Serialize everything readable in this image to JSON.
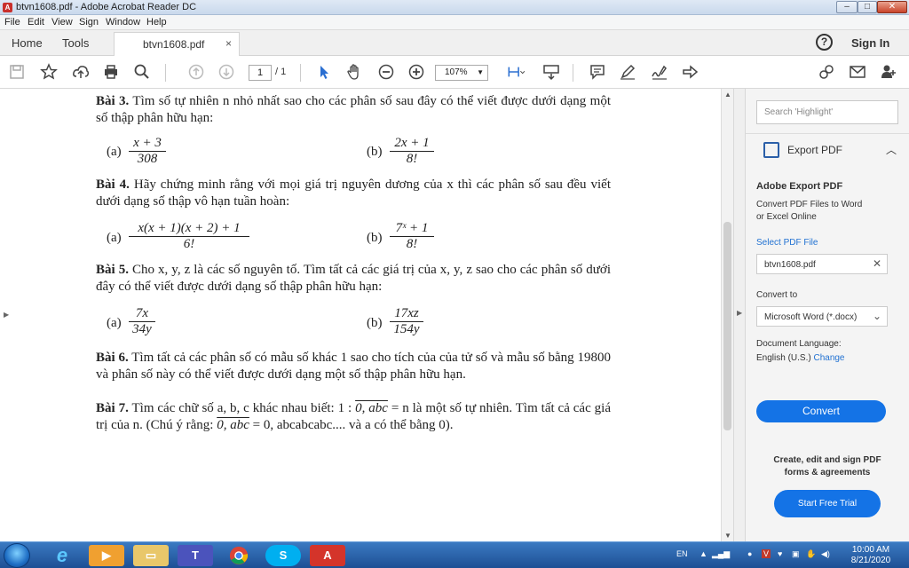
{
  "window": {
    "title": "btvn1608.pdf - Adobe Acrobat Reader DC",
    "min": "‒",
    "max": "□",
    "close": "✕"
  },
  "menu": [
    "File",
    "Edit",
    "View",
    "Sign",
    "Window",
    "Help"
  ],
  "tabs": {
    "home": "Home",
    "tools": "Tools",
    "doc": "btvn1608.pdf",
    "close": "×",
    "help": "?",
    "signin": "Sign In"
  },
  "toolbar": {
    "page": "1",
    "page_total": "/ 1",
    "zoom": "107%"
  },
  "document": {
    "b3": {
      "title": "Bài 3.",
      "text": "Tìm số tự nhiên n nhỏ nhất sao cho các phân số sau đây có thể viết được dưới dạng một số thập phân hữu hạn:",
      "a_label": "(a)",
      "a_num": "x + 3",
      "a_den": "308",
      "b_label": "(b)",
      "b_num": "2x + 1",
      "b_den": "8!"
    },
    "b4": {
      "title": "Bài 4.",
      "text": "Hãy chứng minh rằng với mọi giá trị nguyên dương của x thì các phân số sau đều viết dưới dạng số thập vô hạn tuần hoàn:",
      "a_label": "(a)",
      "a_num": "x(x + 1)(x + 2) + 1",
      "a_den": "6!",
      "b_label": "(b)",
      "b_num": "7ˣ + 1",
      "b_den": "8!"
    },
    "b5": {
      "title": "Bài 5.",
      "text": "Cho x, y, z là các số nguyên tố. Tìm tất cả các giá trị của x, y, z sao cho các phân số dưới đây có thể viết được dưới dạng số thập phân hữu hạn:",
      "a_label": "(a)",
      "a_num": "7x",
      "a_den": "34y",
      "b_label": "(b)",
      "b_num": "17xz",
      "b_den": "154y"
    },
    "b6": {
      "title": "Bài 6.",
      "text": "Tìm tất cả các phân số có mẫu số khác 1 sao cho tích của của tử số và mẫu số bằng 19800 và phân số này có thể viết được dưới dạng một số thập phân hữu hạn."
    },
    "b7": {
      "title": "Bài 7.",
      "text1": "Tìm các chữ số a, b, c khác nhau biết: 1 : ",
      "ovl1": "0, abc",
      "text2": " = n là một số tự nhiên. Tìm tất cả các giá trị của n. (Chú ý rằng: ",
      "ovl2": "0, abc",
      "text3": " = 0, abcabcabc.... và a có thể bằng 0)."
    }
  },
  "panel": {
    "search_placeholder": "Search 'Highlight'",
    "export_header": "Export PDF",
    "adobe_export": "Adobe Export PDF",
    "convert_desc": "Convert PDF Files to Word or Excel Online",
    "select_file": "Select PDF File",
    "file_name": "btvn1608.pdf",
    "convert_to": "Convert to",
    "format": "Microsoft Word (*.docx)",
    "doc_lang": "Document Language:",
    "lang": "English (U.S.)",
    "change": "Change",
    "convert_btn": "Convert",
    "promo": "Create, edit and sign PDF forms & agreements",
    "trial_btn": "Start Free Trial"
  },
  "taskbar": {
    "lang": "EN",
    "time": "10:00 AM",
    "date": "8/21/2020"
  },
  "colors": {
    "accent": "#1473e6",
    "taskbar": "#2a63aa"
  }
}
